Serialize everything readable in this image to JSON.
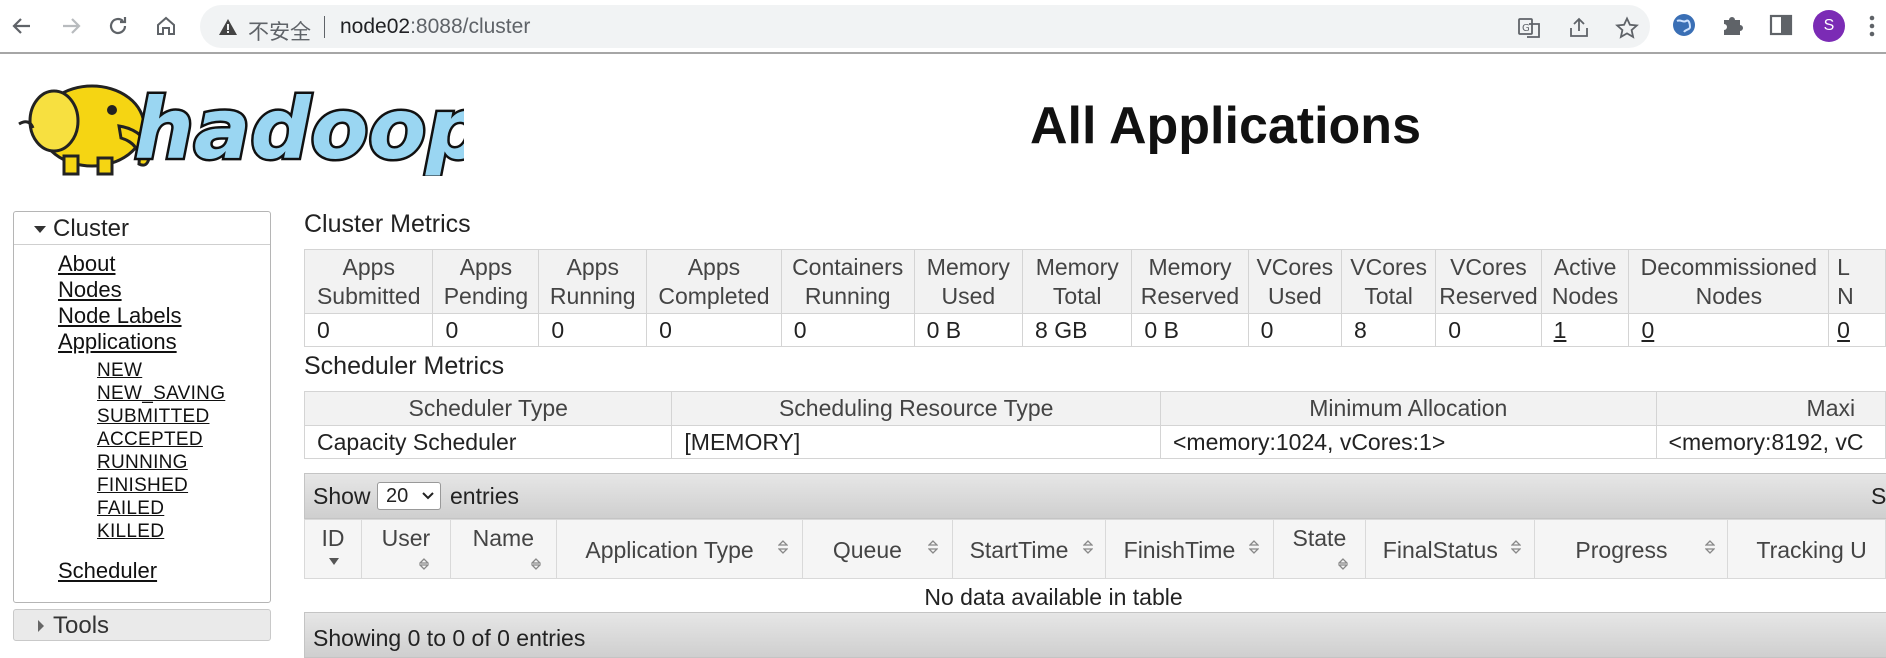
{
  "browser": {
    "security_label": "不安全",
    "url_host": "node02",
    "url_rest": ":8088/cluster",
    "avatar_letter": "S"
  },
  "page": {
    "title": "All Applications",
    "logo_text": "hadoop"
  },
  "sidebar": {
    "cluster_label": "Cluster",
    "links": [
      "About",
      "Nodes",
      "Node Labels",
      "Applications"
    ],
    "app_states": [
      "NEW",
      "NEW_SAVING",
      "SUBMITTED",
      "ACCEPTED",
      "RUNNING",
      "FINISHED",
      "FAILED",
      "KILLED"
    ],
    "scheduler_label": "Scheduler",
    "tools_label": "Tools"
  },
  "cluster_metrics": {
    "title": "Cluster Metrics",
    "headers": [
      [
        "Apps",
        "Submitted"
      ],
      [
        "Apps",
        "Pending"
      ],
      [
        "Apps",
        "Running"
      ],
      [
        "Apps",
        "Completed"
      ],
      [
        "Containers",
        "Running"
      ],
      [
        "Memory",
        "Used"
      ],
      [
        "Memory",
        "Total"
      ],
      [
        "Memory",
        "Reserved"
      ],
      [
        "VCores",
        "Used"
      ],
      [
        "VCores",
        "Total"
      ],
      [
        "VCores",
        "Reserved"
      ],
      [
        "Active",
        "Nodes"
      ],
      [
        "Decommissioned",
        "Nodes"
      ],
      [
        "L",
        "N"
      ]
    ],
    "values": [
      "0",
      "0",
      "0",
      "0",
      "0",
      "0 B",
      "8 GB",
      "0 B",
      "0",
      "8",
      "0",
      "1",
      "0",
      "0"
    ]
  },
  "scheduler_metrics": {
    "title": "Scheduler Metrics",
    "headers": [
      "Scheduler Type",
      "Scheduling Resource Type",
      "Minimum Allocation",
      "Maxi"
    ],
    "values": [
      "Capacity Scheduler",
      "[MEMORY]",
      "<memory:1024, vCores:1>",
      "<memory:8192, vC"
    ]
  },
  "apps_table": {
    "show_label": "Show",
    "page_size": "20",
    "entries_label": "entries",
    "search_label": "Se",
    "columns": [
      "ID",
      "User",
      "Name",
      "Application Type",
      "Queue",
      "StartTime",
      "FinishTime",
      "State",
      "FinalStatus",
      "Progress",
      "Tracking U"
    ],
    "empty_message": "No data available in table",
    "info": "Showing 0 to 0 of 0 entries"
  }
}
